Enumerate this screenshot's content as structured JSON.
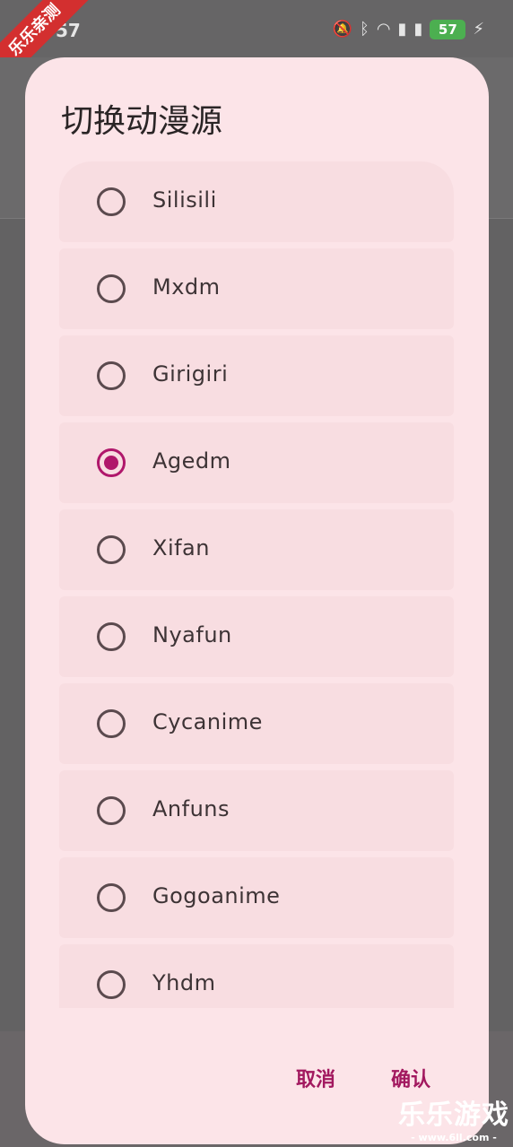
{
  "status_bar": {
    "time": "57",
    "battery": "57",
    "badge_text": "乐乐亲测",
    "icons": [
      "mute-icon",
      "bluetooth-icon",
      "wifi-icon",
      "5g-signal-icon",
      "5g-signal-icon",
      "charging-icon"
    ]
  },
  "dialog": {
    "title": "切换动漫源",
    "options": [
      {
        "label": "Silisili",
        "checked": false
      },
      {
        "label": "Mxdm",
        "checked": false
      },
      {
        "label": "Girigiri",
        "checked": false
      },
      {
        "label": "Agedm",
        "checked": true
      },
      {
        "label": "Xifan",
        "checked": false
      },
      {
        "label": "Nyafun",
        "checked": false
      },
      {
        "label": "Cycanime",
        "checked": false
      },
      {
        "label": "Anfuns",
        "checked": false
      },
      {
        "label": "Gogoanime",
        "checked": false
      },
      {
        "label": "Yhdm",
        "checked": false
      }
    ],
    "cancel_label": "取消",
    "confirm_label": "确认"
  },
  "watermark": {
    "main": "乐乐游戏",
    "sub": "- www.6ll.com -"
  },
  "colors": {
    "accent": "#b0176b",
    "dialog_bg": "#fce4e8",
    "option_bg": "#f8dde1",
    "scrim": "#636263"
  }
}
